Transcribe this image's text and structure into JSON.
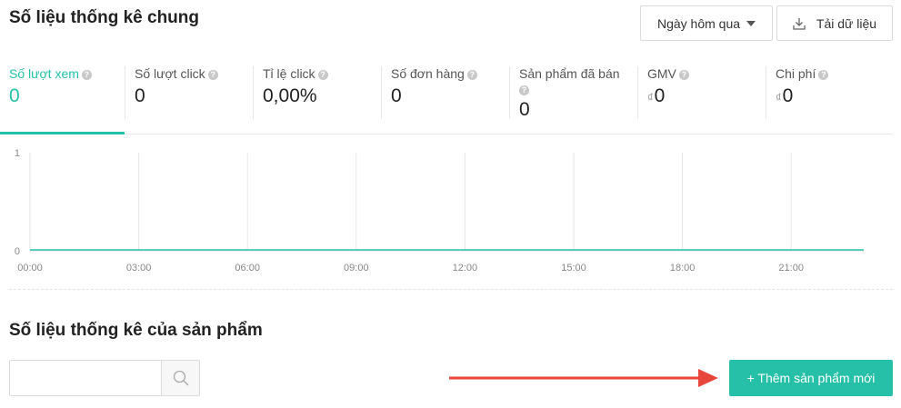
{
  "header": {
    "title": "Số liệu thống kê chung",
    "date_select": "Ngày hôm qua",
    "download_label": "Tải dữ liệu"
  },
  "metrics": [
    {
      "label": "Số lượt xem",
      "value": "0",
      "currency": "",
      "active": true
    },
    {
      "label": "Số lượt click",
      "value": "0",
      "currency": ""
    },
    {
      "label": "Tỉ lệ click",
      "value": "0,00%",
      "currency": ""
    },
    {
      "label": "Số đơn hàng",
      "value": "0",
      "currency": ""
    },
    {
      "label": "Sản phẩm đã bán",
      "value": "0",
      "currency": ""
    },
    {
      "label": "GMV",
      "value": "0",
      "currency": "₫"
    },
    {
      "label": "Chi phí",
      "value": "0",
      "currency": "₫"
    }
  ],
  "chart_data": {
    "type": "line",
    "x": [
      "00:00",
      "03:00",
      "06:00",
      "09:00",
      "12:00",
      "15:00",
      "18:00",
      "21:00"
    ],
    "y_ticks": [
      "1",
      "0"
    ],
    "ylim": [
      0,
      1
    ],
    "series": [
      {
        "values": [
          0,
          0,
          0,
          0,
          0,
          0,
          0,
          0,
          0,
          0,
          0,
          0,
          0,
          0,
          0,
          0,
          0,
          0,
          0,
          0,
          0,
          0,
          0,
          0
        ],
        "color": "#26c0a8"
      }
    ],
    "grid": true
  },
  "products": {
    "title": "Số liệu thống kê của sản phẩm",
    "search_placeholder": "",
    "add_label": "+ Thêm sản phẩm mới"
  },
  "colors": {
    "accent": "#26c0a8",
    "arrow": "#e8453c"
  }
}
